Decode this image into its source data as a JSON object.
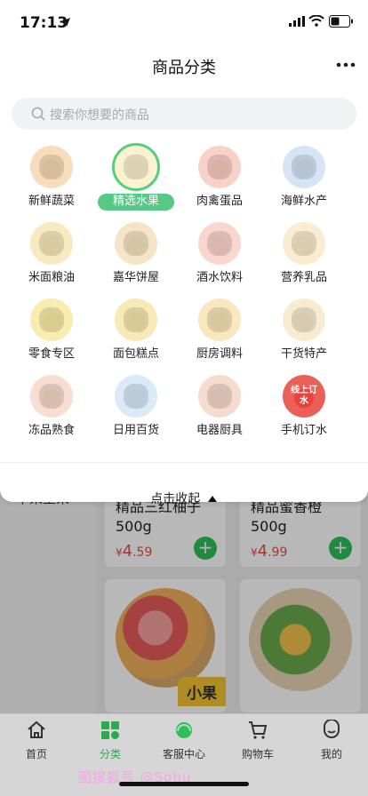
{
  "status_bar": {
    "time": "17:13"
  },
  "header": {
    "title": "商品分类"
  },
  "search": {
    "placeholder": "搜索你想要的商品"
  },
  "categories": [
    {
      "label": "新鲜蔬菜",
      "icon": "vegetables-icon",
      "color": "#f6d7b0"
    },
    {
      "label": "精选水果",
      "icon": "fruit-icon",
      "color": "#f9f0c9",
      "selected": true
    },
    {
      "label": "肉禽蛋品",
      "icon": "meat-icon",
      "color": "#f7c9c0"
    },
    {
      "label": "海鲜水产",
      "icon": "seafood-icon",
      "color": "#cfe0f3"
    },
    {
      "label": "米面粮油",
      "icon": "grain-oil-icon",
      "color": "#f7e7b5"
    },
    {
      "label": "嘉华饼屋",
      "icon": "bakery-icon",
      "color": "#f5dfbd"
    },
    {
      "label": "酒水饮料",
      "icon": "drinks-icon",
      "color": "#f8d0c6"
    },
    {
      "label": "营养乳品",
      "icon": "dairy-icon",
      "color": "#f9e9c8"
    },
    {
      "label": "零食专区",
      "icon": "snacks-icon",
      "color": "#f7e9a0"
    },
    {
      "label": "面包糕点",
      "icon": "bread-icon",
      "color": "#f6e6a9"
    },
    {
      "label": "厨房调料",
      "icon": "seasoning-icon",
      "color": "#f8e3b3"
    },
    {
      "label": "干货特产",
      "icon": "dried-goods-icon",
      "color": "#f6e8ca"
    },
    {
      "label": "冻品熟食",
      "icon": "frozen-food-icon",
      "color": "#f7d7c9"
    },
    {
      "label": "日用百货",
      "icon": "daily-goods-icon",
      "color": "#d3e6f6"
    },
    {
      "label": "电器厨具",
      "icon": "appliance-icon",
      "color": "#f3d6c6"
    },
    {
      "label": "手机订水",
      "icon": "water-order-icon",
      "color": "#e7433a",
      "sub": "线上订水"
    }
  ],
  "collapse": {
    "label": "点击收起"
  },
  "background": {
    "sidebar_item": "干果坚果",
    "products": [
      {
        "name": "精品三红柚子",
        "spec": "500g",
        "currency": "¥",
        "price_int": "4",
        "price_dec": ".59"
      },
      {
        "name": "精品蜜香橙",
        "spec": "500g",
        "currency": "¥",
        "price_int": "4",
        "price_dec": ".99"
      }
    ],
    "tag": "小果"
  },
  "tabbar": [
    {
      "label": "首页",
      "icon": "home-icon"
    },
    {
      "label": "分类",
      "icon": "category-icon",
      "active": true
    },
    {
      "label": "客服中心",
      "icon": "service-icon"
    },
    {
      "label": "购物车",
      "icon": "cart-icon"
    },
    {
      "label": "我的",
      "icon": "profile-icon"
    }
  ],
  "watermark": "图搜狐号 @Sohu",
  "colors": {
    "accent": "#2fa850",
    "price": "#e54d42",
    "selected_pill": "#57c985"
  }
}
